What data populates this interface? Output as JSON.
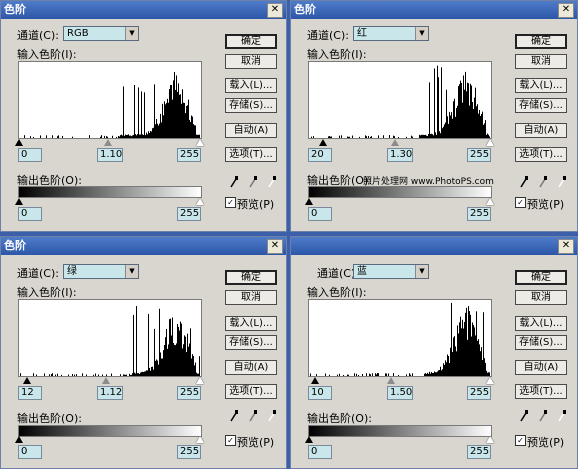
{
  "dialogs": [
    {
      "title": "色阶",
      "channel_label": "通道(C):",
      "channel_value": "RGB",
      "input_label": "输入色阶(I):",
      "input_black": "0",
      "input_gamma": "1.10",
      "input_white": "255",
      "output_label": "输出色阶(O):",
      "output_black": "0",
      "output_white": "255",
      "ok": "确定",
      "cancel": "取消",
      "load": "载入(L)...",
      "save": "存储(S)...",
      "auto": "自动(A)",
      "options": "选项(T)...",
      "preview": "预览(P)",
      "preview_checked": true
    },
    {
      "title": "色阶",
      "channel_label": "通道(C):",
      "channel_value": "红",
      "input_label": "输入色阶(I):",
      "input_black": "20",
      "input_gamma": "1.30",
      "input_white": "255",
      "output_label": "输出色阶(O):",
      "output_black": "0",
      "output_white": "255",
      "ok": "确定",
      "cancel": "取消",
      "load": "载入(L)...",
      "save": "存储(S)...",
      "auto": "自动(A)",
      "options": "选项(T)...",
      "preview": "预览(P)",
      "preview_checked": true,
      "watermark": "照片处理网 www.PhotoPS.com"
    },
    {
      "title": "色阶",
      "channel_label": "通道(C):",
      "channel_value": "绿",
      "input_label": "输入色阶(I):",
      "input_black": "12",
      "input_gamma": "1.12",
      "input_white": "255",
      "output_label": "输出色阶(O):",
      "output_black": "0",
      "output_white": "255",
      "ok": "确定",
      "cancel": "取消",
      "load": "载入(L)...",
      "save": "存储(S)...",
      "auto": "自动(A)",
      "options": "选项(T)...",
      "preview": "预览(P)",
      "preview_checked": true
    },
    {
      "title": "",
      "channel_label": "通道(C):",
      "channel_value": "蓝",
      "input_label": "输入色阶(I):",
      "input_black": "10",
      "input_gamma": "1.50",
      "input_white": "255",
      "output_label": "输出色阶(O):",
      "output_black": "0",
      "output_white": "255",
      "ok": "确定",
      "cancel": "取消",
      "load": "载入(L)...",
      "save": "存储(S)...",
      "auto": "自动(A)",
      "options": "选项(T)...",
      "preview": "预览(P)",
      "preview_checked": true
    }
  ],
  "icons": [
    "close-icon",
    "eyedropper-black-icon",
    "eyedropper-gray-icon",
    "eyedropper-white-icon",
    "dropdown-arrow-icon"
  ]
}
